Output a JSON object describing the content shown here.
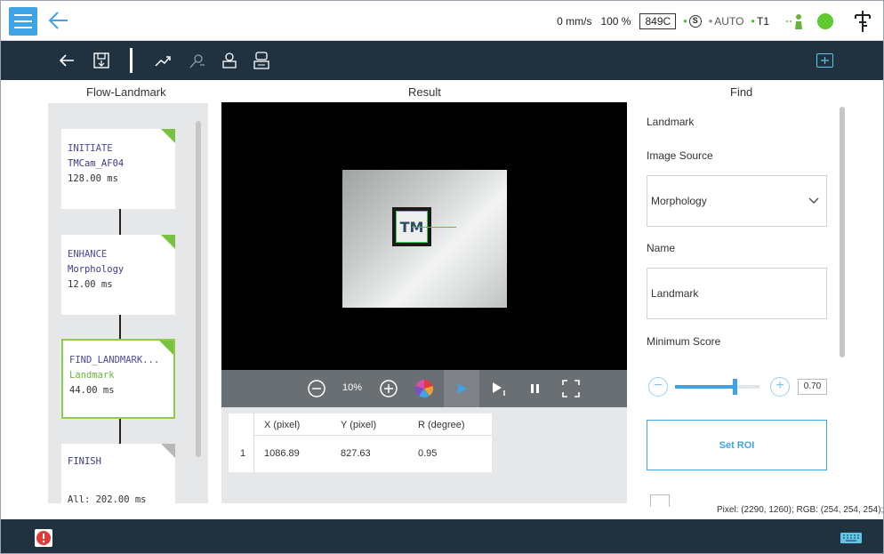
{
  "status": {
    "speed": "0 mm/s",
    "percent": "100 %",
    "robot_id": "849C",
    "mode_auto": "AUTO",
    "mode_t1": "T1"
  },
  "columns": {
    "flow": "Flow-Landmark",
    "result": "Result",
    "find": "Find"
  },
  "flow_nodes": [
    {
      "type": "INITIATE",
      "name": "TMCam_AF04",
      "time": "128.00 ms"
    },
    {
      "type": "ENHANCE",
      "name": "Morphology",
      "time": "12.00 ms"
    },
    {
      "type": "FIND_LANDMARK...",
      "name": "Landmark",
      "time": "44.00 ms"
    },
    {
      "type": "FINISH",
      "time": "All: 202.00 ms"
    }
  ],
  "viewer": {
    "zoom": "10%",
    "marker_text": "TM"
  },
  "result_table": {
    "headers": [
      "X (pixel)",
      "Y (pixel)",
      "R (degree)"
    ],
    "rows": [
      {
        "index": "1",
        "x": "1086.89",
        "y": "827.63",
        "r": "0.95"
      }
    ]
  },
  "find": {
    "section": "Landmark",
    "image_source_label": "Image Source",
    "image_source_value": "Morphology",
    "name_label": "Name",
    "name_value": "Landmark",
    "min_score_label": "Minimum Score",
    "min_score_value": "0.70",
    "min_score_fraction": 0.7,
    "set_roi": "Set ROI",
    "pixel_info": "Pixel: (2290, 1260); RGB: (254, 254, 254);"
  },
  "colors": {
    "accent": "#3fa3e6",
    "toolbar": "#20313f",
    "node_done": "#78c23f",
    "status_ok": "#5fcc2e",
    "error": "#e03b3b"
  }
}
